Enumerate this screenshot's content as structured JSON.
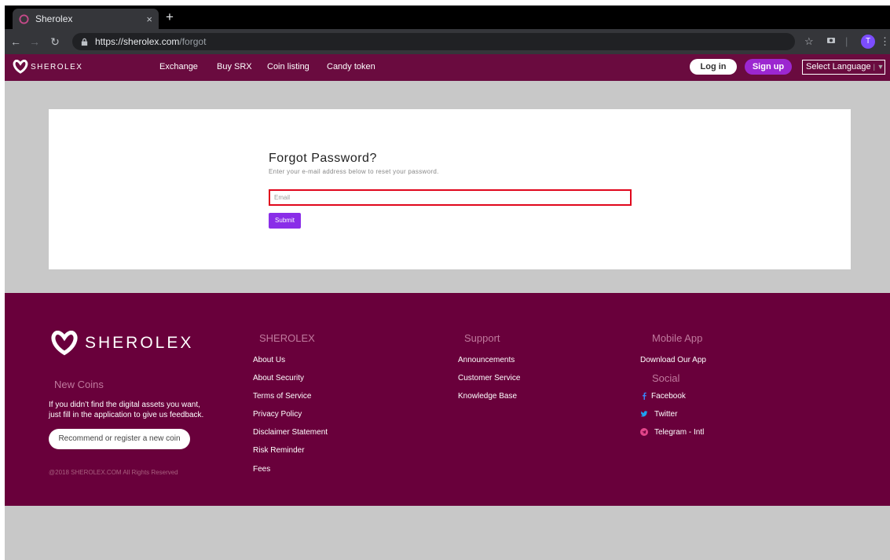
{
  "browser": {
    "tab_title": "Sherolex",
    "tab_close": "×",
    "new_tab": "+",
    "url_host": "https://sherolex.com",
    "url_path": "/forgot",
    "profile_initial": "T"
  },
  "nav": {
    "brand": "SHEROLEX",
    "links": [
      "Exchange",
      "Buy SRX",
      "Coin listing",
      "Candy token"
    ],
    "login": "Log in",
    "signup": "Sign up",
    "language": "Select Language",
    "language_arrow": "| ▼"
  },
  "form": {
    "title": "Forgot Password?",
    "subtitle": "Enter your e-mail address below to reset your password.",
    "email_placeholder": "Email",
    "submit": "Submit"
  },
  "footer": {
    "brand": "SHEROLEX",
    "new_coins_heading": "New Coins",
    "new_coins_text1": "If you didn’t find the digital assets you want,",
    "new_coins_text2": "just fill in the application to give us feedback.",
    "recommend_button": "Recommend or register a new coin",
    "copyright": "@2018 SHEROLEX.COM All Rights Reserved",
    "col1_heading": "SHEROLEX",
    "col1_links": [
      "About Us",
      "About Security",
      "Terms of Service",
      "Privacy Policy",
      "Disclaimer Statement",
      "Risk Reminder",
      "Fees"
    ],
    "col2_heading": "Support",
    "col2_links": [
      "Announcements",
      "Customer Service",
      "Knowledge Base"
    ],
    "col3_heading": "Mobile App",
    "download": "Download Our App",
    "social_heading": "Social",
    "social": [
      "Facebook",
      "Twitter",
      "Telegram - Intl"
    ]
  },
  "colors": {
    "brand": "#69003b",
    "accent": "#8a2ee8",
    "highlight": "#e0061c"
  }
}
